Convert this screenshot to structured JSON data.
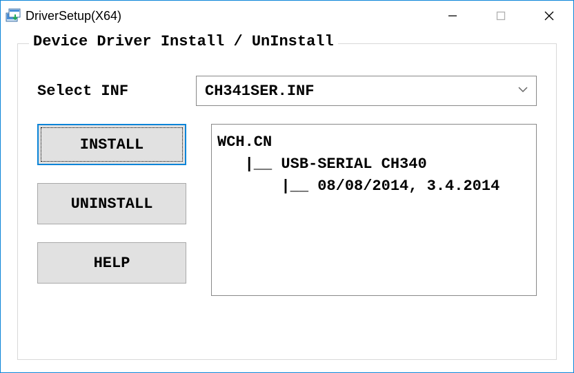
{
  "window": {
    "title": "DriverSetup(X64)"
  },
  "group": {
    "legend": "Device Driver Install / UnInstall",
    "select_label": "Select INF",
    "selected_inf": "CH341SER.INF"
  },
  "buttons": {
    "install": "INSTALL",
    "uninstall": "UNINSTALL",
    "help": "HELP"
  },
  "info": {
    "line1": "WCH.CN",
    "line2": "   |__ USB-SERIAL CH340",
    "line3": "       |__ 08/08/2014, 3.4.2014"
  }
}
